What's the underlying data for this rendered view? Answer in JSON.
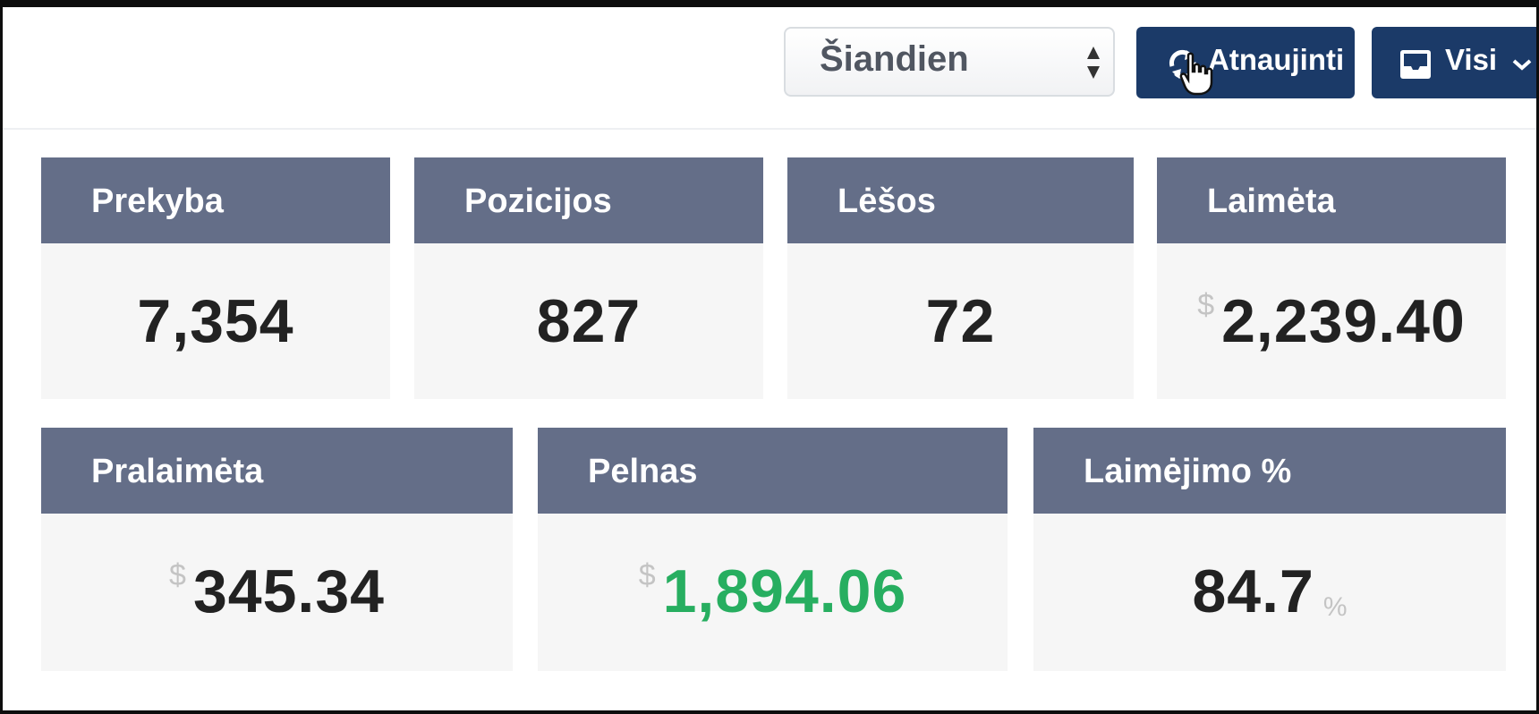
{
  "toolbar": {
    "period_select": {
      "value": "Šiandien"
    },
    "refresh_button": {
      "label": "Atnaujinti"
    },
    "filter_button": {
      "label": "Visi"
    }
  },
  "stats_row1": [
    {
      "title": "Prekyba",
      "value": "7,354"
    },
    {
      "title": "Pozicijos",
      "value": "827"
    },
    {
      "title": "Lėšos",
      "value": "72"
    },
    {
      "title": "Laimėta",
      "currency": "$",
      "value": "2,239.40"
    }
  ],
  "stats_row2": [
    {
      "title": "Pralaimėta",
      "currency": "$",
      "value": "345.34"
    },
    {
      "title": "Pelnas",
      "currency": "$",
      "value": "1,894.06"
    },
    {
      "title": "Laimėjimo %",
      "value": "84.7",
      "unit": "%"
    }
  ],
  "colors": {
    "header": "#646e88",
    "button": "#1b3a68",
    "profit": "#27ae60"
  },
  "icons": [
    "refresh-icon",
    "inbox-icon",
    "chevron-down-icon",
    "hand-cursor-icon",
    "select-arrows-icon"
  ]
}
